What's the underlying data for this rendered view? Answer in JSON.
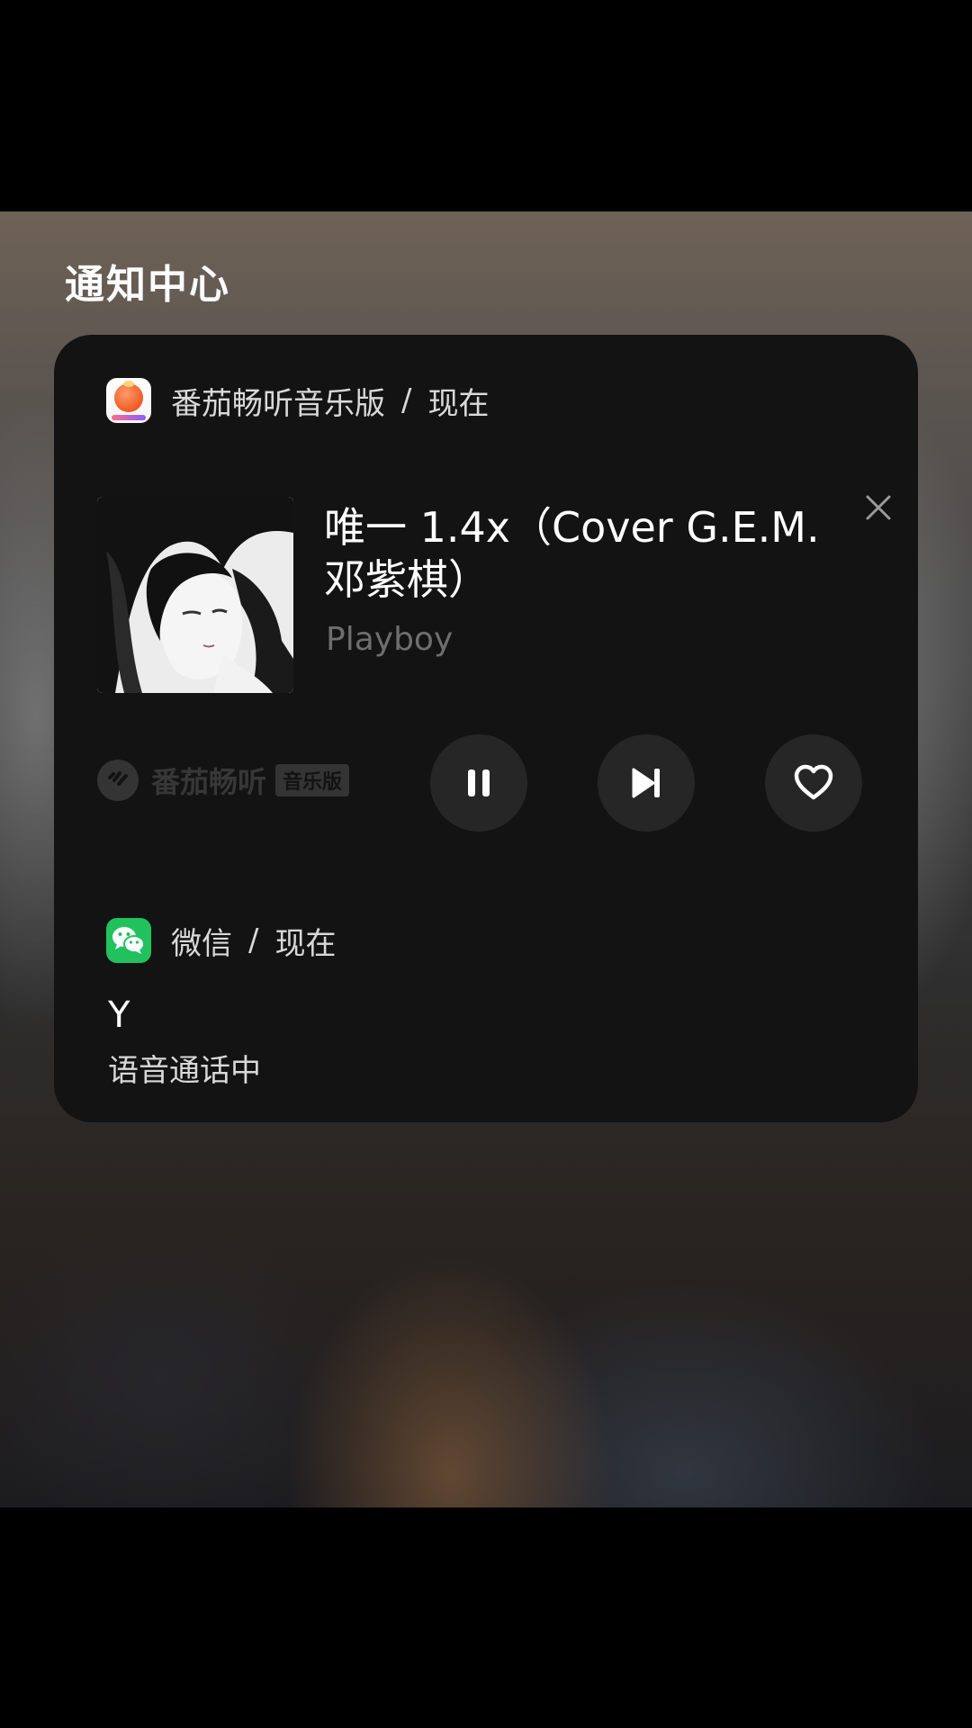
{
  "notification_center": {
    "title": "通知中心"
  },
  "music_notification": {
    "app_name": "番茄畅听音乐版",
    "separator": "/",
    "time": "现在",
    "song_title": "唯一 1.4x（Cover G.E.M. 邓紫棋）",
    "artist": "Playboy",
    "brand_text": "番茄畅听",
    "brand_tag": "音乐版",
    "icons": {
      "app": "tomato-app-icon",
      "close": "close-icon",
      "pause": "pause-icon",
      "next": "skip-next-icon",
      "like": "heart-icon",
      "brand": "tomato-brand-logo"
    }
  },
  "wechat_notification": {
    "app_name": "微信",
    "separator": "/",
    "time": "现在",
    "sender": "Y",
    "message": "语音通话中",
    "icons": {
      "app": "wechat-icon"
    }
  },
  "colors": {
    "card_bg": "#131313",
    "control_bg": "#262626",
    "wechat_green": "#21c25e",
    "tomato_orange": "#f15a24"
  }
}
